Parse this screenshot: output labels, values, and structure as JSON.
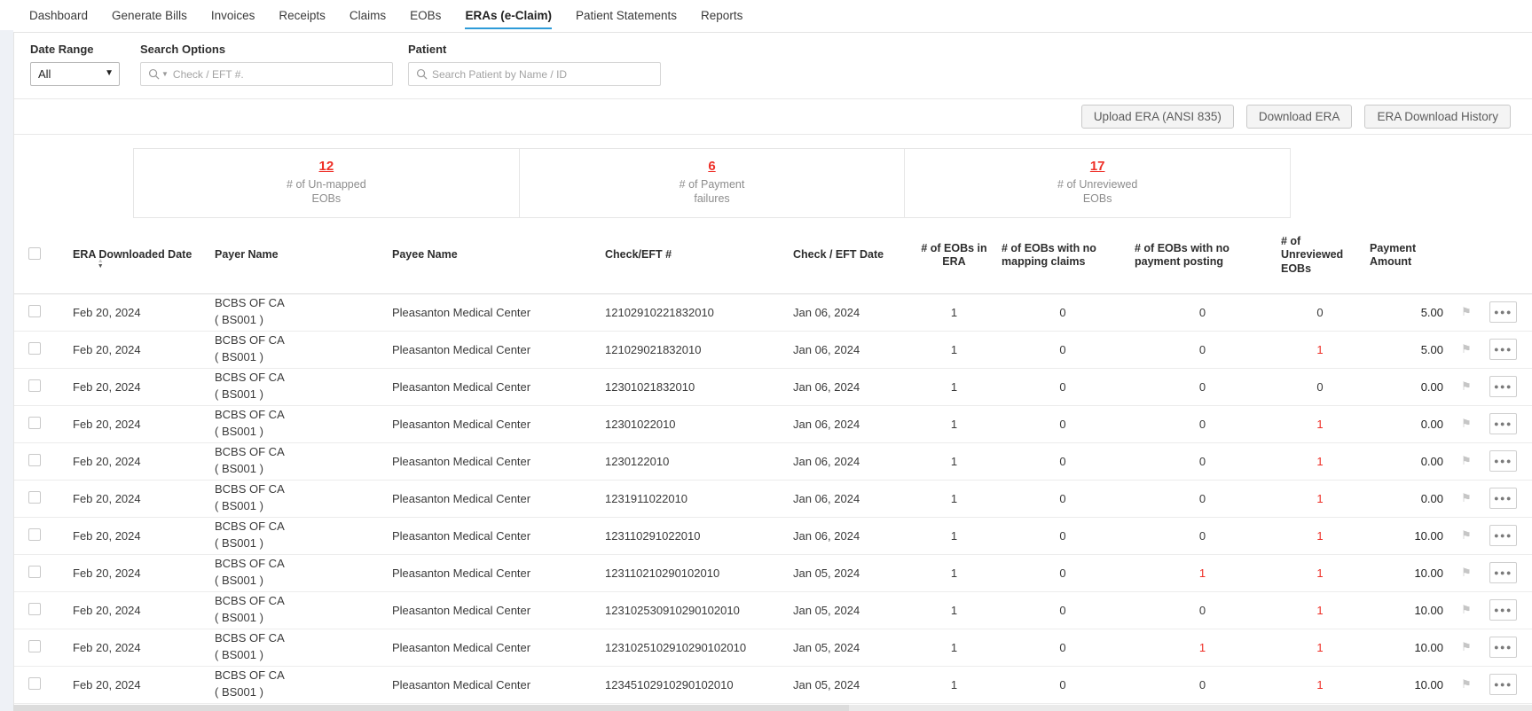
{
  "nav": {
    "tabs": [
      "Dashboard",
      "Generate Bills",
      "Invoices",
      "Receipts",
      "Claims",
      "EOBs",
      "ERAs (e-Claim)",
      "Patient Statements",
      "Reports"
    ],
    "active_tab": "ERAs (e-Claim)"
  },
  "filters": {
    "date_range": {
      "label": "Date Range",
      "value": "All"
    },
    "search_options": {
      "label": "Search Options",
      "placeholder": "Check / EFT #."
    },
    "patient": {
      "label": "Patient",
      "placeholder": "Search Patient by Name / ID"
    }
  },
  "toolbar": {
    "upload_label": "Upload ERA (ANSI 835)",
    "download_label": "Download ERA",
    "history_label": "ERA Download History"
  },
  "summary": [
    {
      "value": "12",
      "label_line1": "# of Un-mapped",
      "label_line2": "EOBs"
    },
    {
      "value": "6",
      "label_line1": "# of Payment",
      "label_line2": "failures"
    },
    {
      "value": "17",
      "label_line1": "# of Unreviewed",
      "label_line2": "EOBs"
    }
  ],
  "table": {
    "headers": {
      "era_date": "ERA Downloaded Date",
      "payer": "Payer Name",
      "payee": "Payee Name",
      "check": "Check/EFT #",
      "check_date": "Check / EFT Date",
      "eobs_in_era": "# of EOBs in ERA",
      "no_mapping": "# of EOBs with no mapping claims",
      "no_posting": "# of EOBs with no payment posting",
      "unreviewed": "# of Unreviewed EOBs",
      "amount": "Payment Amount"
    },
    "rows": [
      {
        "era_date": "Feb 20, 2024",
        "payer_line1": "BCBS OF CA",
        "payer_line2": "( BS001 )",
        "payee": "Pleasanton Medical Center",
        "check": "12102910221832010",
        "check_date": "Jan 06, 2024",
        "eobs_in_era": "1",
        "no_mapping": "0",
        "no_posting": "0",
        "no_posting_red": false,
        "unreviewed": "0",
        "unreviewed_red": false,
        "amount": "5.00"
      },
      {
        "era_date": "Feb 20, 2024",
        "payer_line1": "BCBS OF CA",
        "payer_line2": "( BS001 )",
        "payee": "Pleasanton Medical Center",
        "check": "121029021832010",
        "check_date": "Jan 06, 2024",
        "eobs_in_era": "1",
        "no_mapping": "0",
        "no_posting": "0",
        "no_posting_red": false,
        "unreviewed": "1",
        "unreviewed_red": true,
        "amount": "5.00"
      },
      {
        "era_date": "Feb 20, 2024",
        "payer_line1": "BCBS OF CA",
        "payer_line2": "( BS001 )",
        "payee": "Pleasanton Medical Center",
        "check": "12301021832010",
        "check_date": "Jan 06, 2024",
        "eobs_in_era": "1",
        "no_mapping": "0",
        "no_posting": "0",
        "no_posting_red": false,
        "unreviewed": "0",
        "unreviewed_red": false,
        "amount": "0.00"
      },
      {
        "era_date": "Feb 20, 2024",
        "payer_line1": "BCBS OF CA",
        "payer_line2": "( BS001 )",
        "payee": "Pleasanton Medical Center",
        "check": "12301022010",
        "check_date": "Jan 06, 2024",
        "eobs_in_era": "1",
        "no_mapping": "0",
        "no_posting": "0",
        "no_posting_red": false,
        "unreviewed": "1",
        "unreviewed_red": true,
        "amount": "0.00"
      },
      {
        "era_date": "Feb 20, 2024",
        "payer_line1": "BCBS OF CA",
        "payer_line2": "( BS001 )",
        "payee": "Pleasanton Medical Center",
        "check": "1230122010",
        "check_date": "Jan 06, 2024",
        "eobs_in_era": "1",
        "no_mapping": "0",
        "no_posting": "0",
        "no_posting_red": false,
        "unreviewed": "1",
        "unreviewed_red": true,
        "amount": "0.00"
      },
      {
        "era_date": "Feb 20, 2024",
        "payer_line1": "BCBS OF CA",
        "payer_line2": "( BS001 )",
        "payee": "Pleasanton Medical Center",
        "check": "1231911022010",
        "check_date": "Jan 06, 2024",
        "eobs_in_era": "1",
        "no_mapping": "0",
        "no_posting": "0",
        "no_posting_red": false,
        "unreviewed": "1",
        "unreviewed_red": true,
        "amount": "0.00"
      },
      {
        "era_date": "Feb 20, 2024",
        "payer_line1": "BCBS OF CA",
        "payer_line2": "( BS001 )",
        "payee": "Pleasanton Medical Center",
        "check": "123110291022010",
        "check_date": "Jan 06, 2024",
        "eobs_in_era": "1",
        "no_mapping": "0",
        "no_posting": "0",
        "no_posting_red": false,
        "unreviewed": "1",
        "unreviewed_red": true,
        "amount": "10.00"
      },
      {
        "era_date": "Feb 20, 2024",
        "payer_line1": "BCBS OF CA",
        "payer_line2": "( BS001 )",
        "payee": "Pleasanton Medical Center",
        "check": "123110210290102010",
        "check_date": "Jan 05, 2024",
        "eobs_in_era": "1",
        "no_mapping": "0",
        "no_posting": "1",
        "no_posting_red": true,
        "unreviewed": "1",
        "unreviewed_red": true,
        "amount": "10.00"
      },
      {
        "era_date": "Feb 20, 2024",
        "payer_line1": "BCBS OF CA",
        "payer_line2": "( BS001 )",
        "payee": "Pleasanton Medical Center",
        "check": "123102530910290102010",
        "check_date": "Jan 05, 2024",
        "eobs_in_era": "1",
        "no_mapping": "0",
        "no_posting": "0",
        "no_posting_red": false,
        "unreviewed": "1",
        "unreviewed_red": true,
        "amount": "10.00"
      },
      {
        "era_date": "Feb 20, 2024",
        "payer_line1": "BCBS OF CA",
        "payer_line2": "( BS001 )",
        "payee": "Pleasanton Medical Center",
        "check": "1231025102910290102010",
        "check_date": "Jan 05, 2024",
        "eobs_in_era": "1",
        "no_mapping": "0",
        "no_posting": "1",
        "no_posting_red": true,
        "unreviewed": "1",
        "unreviewed_red": true,
        "amount": "10.00"
      },
      {
        "era_date": "Feb 20, 2024",
        "payer_line1": "BCBS OF CA",
        "payer_line2": "( BS001 )",
        "payee": "Pleasanton Medical Center",
        "check": "12345102910290102010",
        "check_date": "Jan 05, 2024",
        "eobs_in_era": "1",
        "no_mapping": "0",
        "no_posting": "0",
        "no_posting_red": false,
        "unreviewed": "1",
        "unreviewed_red": true,
        "amount": "10.00"
      }
    ]
  },
  "icons": {
    "search": "search-icon",
    "caret": "chevron-down-icon",
    "flag": "flag-icon",
    "more": "ellipsis-icon",
    "sort": "sort-icon"
  },
  "colors": {
    "accent_red": "#ee2f27",
    "active_tab_underline": "#2e9bd8",
    "left_strip": "#eef1f6"
  }
}
